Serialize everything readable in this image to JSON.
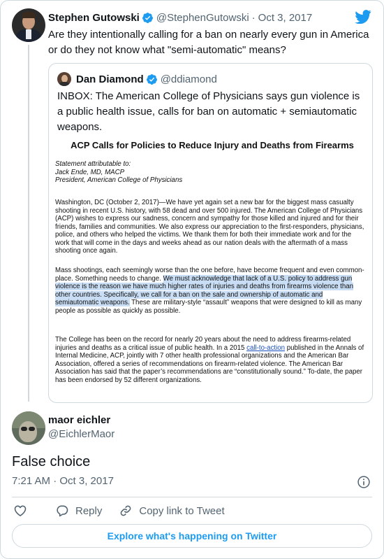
{
  "parent_tweet": {
    "author_name": "Stephen Gutowski",
    "handle": "@StephenGutowski",
    "separator": "·",
    "date": "Oct 3, 2017",
    "text": "Are they intentionally calling for a ban on nearly every gun in America or do they not know what \"semi-automatic\" means?"
  },
  "quoted_tweet": {
    "author_name": "Dan Diamond",
    "handle": "@ddiamond",
    "text": "INBOX: The American College of Physicians says gun violence is a public health issue, calls for ban on automatic + semiautomatic weapons.",
    "document": {
      "title": "ACP Calls for Policies to Reduce Injury and Deaths from Firearms",
      "statement_lines": [
        "Statement attributable to:",
        "Jack Ende, MD, MACP",
        "President, American College of Physicians"
      ],
      "paragraph_1": "Washington, DC (October 2, 2017)—We have yet again set a new bar for the biggest mass casualty shooting in recent U.S. history, with 58 dead and over 500 injured.  The American College of Physicians (ACP) wishes to express our sadness, concern and sympathy for those killed and injured and for their friends, families and communities.  We also express our appreciation to the first-responders, physicians, police, and others who helped the victims.  We thank them for both their immediate work and for the work that will come in the days and weeks ahead as our nation deals with the aftermath of a mass shooting once again.",
      "paragraph_2_plain": "Mass shootings, each seemingly worse than the one before, have become frequent and even common-place.  Something needs to change. ",
      "paragraph_2_highlight": "We must acknowledge that lack of a U.S. policy to address gun violence is the reason we have much higher rates of injuries and deaths from firearms violence than other countries.  Specifically, we call for a ban on the sale and ownership of automatic and semiautomatic weapons.",
      "paragraph_2_tail": "  These are military-style “assault” weapons that were designed to kill as many people as possible as quickly as possible.",
      "paragraph_3_start": "The College has been on the record for nearly 20 years about the need to address firearms-related injuries and deaths as a critical issue of public health.  In a 2015 ",
      "paragraph_3_link": "call-to-action",
      "paragraph_3_end": " published in the Annals of Internal Medicine, ACP, jointly with 7 other health professional organizations and the American Bar Association, offered a series of recommendations on firearm-related violence.  The American Bar Association has said that the paper’s recommendations are “constitutionally sound.” To-date, the paper has been endorsed by 52 different organizations."
    }
  },
  "reply_tweet": {
    "author_name": "maor eichler",
    "handle": "@EichlerMaor",
    "text": "False choice",
    "timestamp": "7:21 AM · Oct 3, 2017"
  },
  "actions": {
    "reply_label": "Reply",
    "copy_link_label": "Copy link to Tweet"
  },
  "explore_label": "Explore what's happening on Twitter",
  "icons": {
    "verified": "verified-badge-icon",
    "twitter_logo": "twitter-bird-icon",
    "info": "info-icon",
    "like": "heart-icon",
    "reply": "speech-bubble-icon",
    "copy_link": "link-icon"
  },
  "colors": {
    "brand_blue": "#1d9bf0",
    "secondary_text": "#536471",
    "border": "#cfd9de",
    "highlight": "#c9def5"
  }
}
